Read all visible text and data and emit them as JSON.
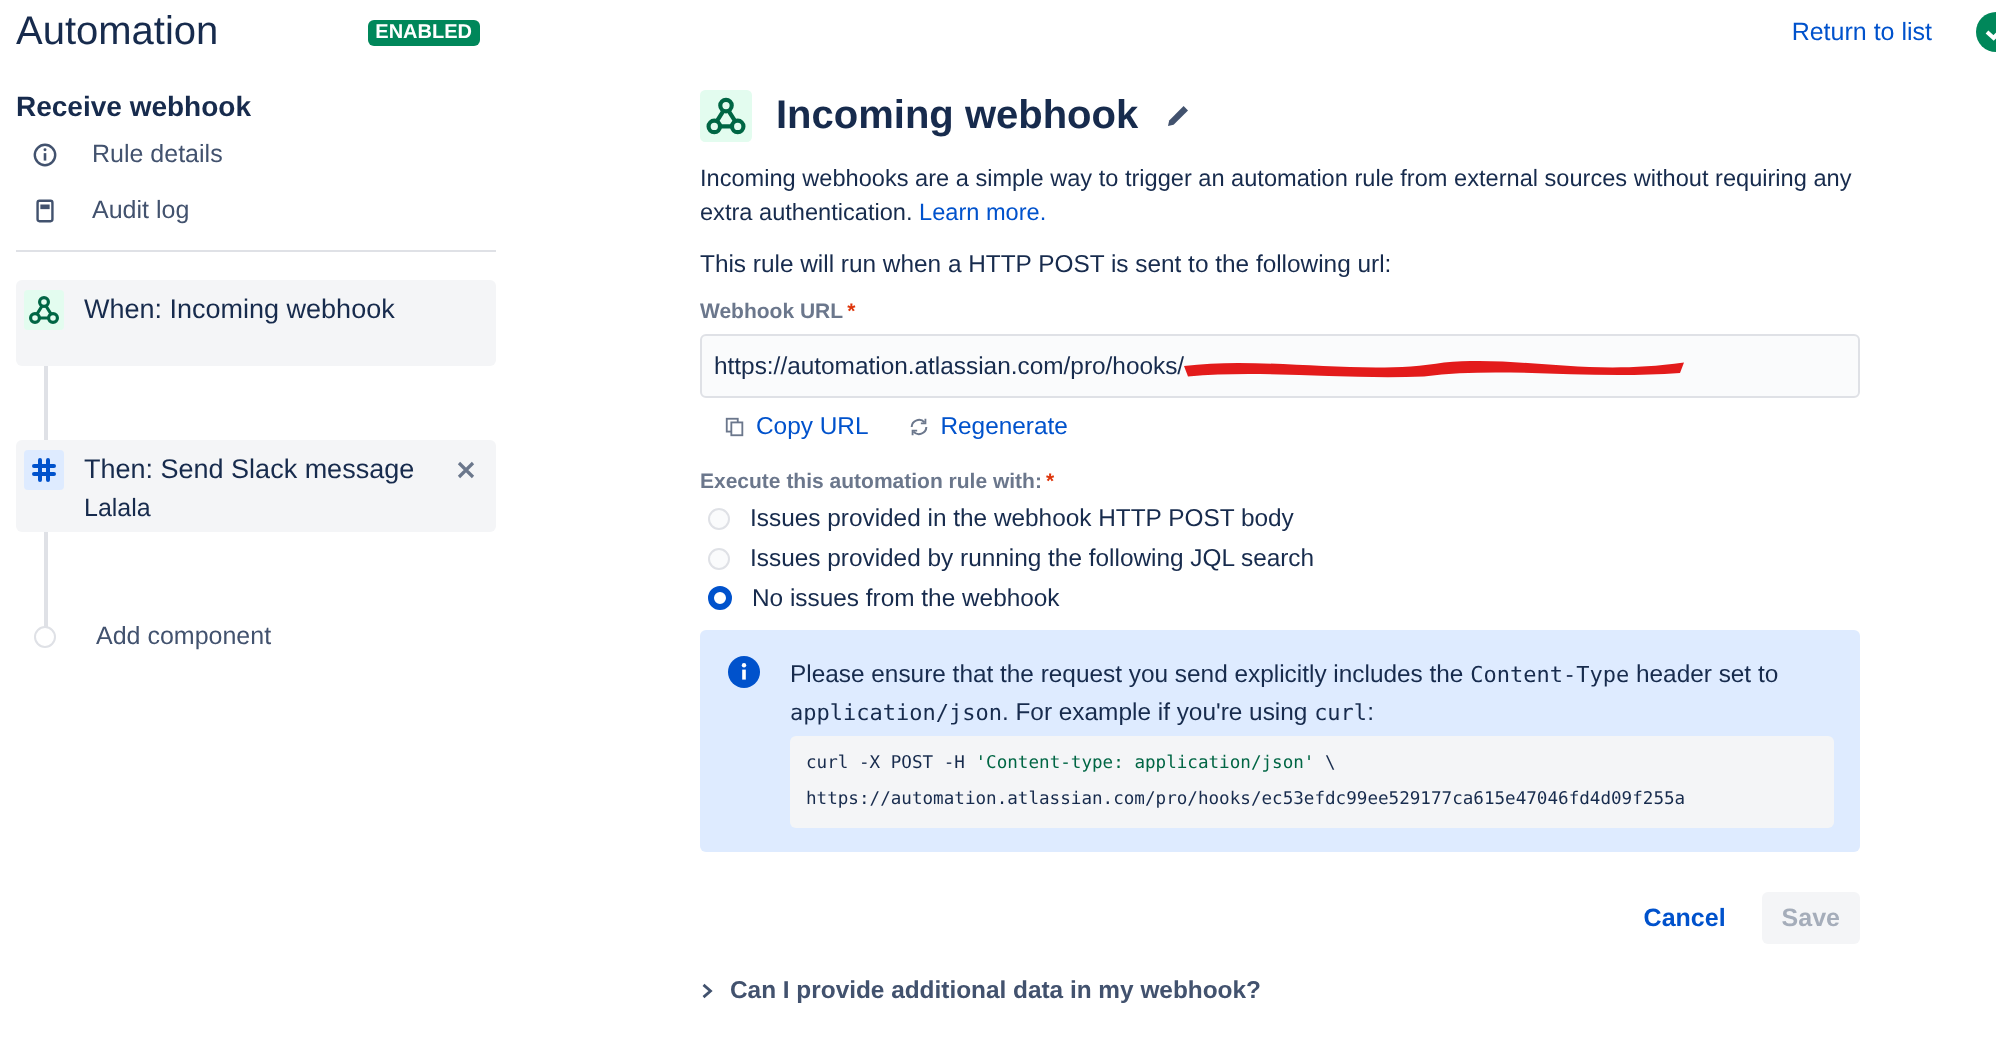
{
  "header": {
    "title": "Automation",
    "status": "ENABLED",
    "return_link": "Return to list"
  },
  "sidebar": {
    "heading": "Receive webhook",
    "items": [
      {
        "label": "Rule details"
      },
      {
        "label": "Audit log"
      }
    ],
    "components": [
      {
        "kind": "trigger",
        "title": "When: Incoming webhook"
      },
      {
        "kind": "action",
        "title": "Then: Send Slack message",
        "subtitle": "Lalala",
        "removable": true
      }
    ],
    "add_label": "Add component"
  },
  "panel": {
    "title": "Incoming webhook",
    "description": "Incoming webhooks are a simple way to trigger an automation rule from external sources without requiring any extra authentication.",
    "learn_more": "Learn more.",
    "instruction": "This rule will run when a HTTP POST is sent to the following url:",
    "url_label": "Webhook URL",
    "url_required_mark": "*",
    "url_value": "https://automation.atlassian.com/pro/hooks/",
    "url_redacted": true,
    "url_actions": [
      {
        "label": "Copy URL"
      },
      {
        "label": "Regenerate"
      }
    ],
    "execute_label": "Execute this automation rule with:",
    "execute_required_mark": "*",
    "options": [
      {
        "label": "Issues provided in the webhook HTTP POST body",
        "selected": false
      },
      {
        "label": "Issues provided by running the following JQL search",
        "selected": false
      },
      {
        "label": "No issues from the webhook",
        "selected": true
      }
    ],
    "note": [
      {
        "text": "Please ensure that the request you send explicitly includes the ",
        "code": false
      },
      {
        "text": "Content-Type",
        "code": true
      },
      {
        "text": " header set to ",
        "code": false
      },
      {
        "text": "application/json",
        "code": true
      },
      {
        "text": ". For example if you're using ",
        "code": false
      },
      {
        "text": "curl",
        "code": true
      },
      {
        "text": ":",
        "code": false
      }
    ],
    "code_lines": [
      [
        {
          "text": "curl -X POST -H ",
          "string": false
        },
        {
          "text": "'Content-type: application/json'",
          "string": true
        },
        {
          "text": " \\",
          "string": false
        }
      ],
      [
        {
          "text": "https://automation.atlassian.com/pro/hooks/ec53efdc99ee529177ca615e47046fd4d09f255a",
          "string": false
        }
      ]
    ],
    "buttons": [
      {
        "label": "Cancel",
        "kind": "link",
        "disabled": false
      },
      {
        "label": "Save",
        "kind": "primary",
        "disabled": true
      }
    ],
    "faq": {
      "label": "Can I provide additional data in my webhook?",
      "expanded": false
    }
  }
}
